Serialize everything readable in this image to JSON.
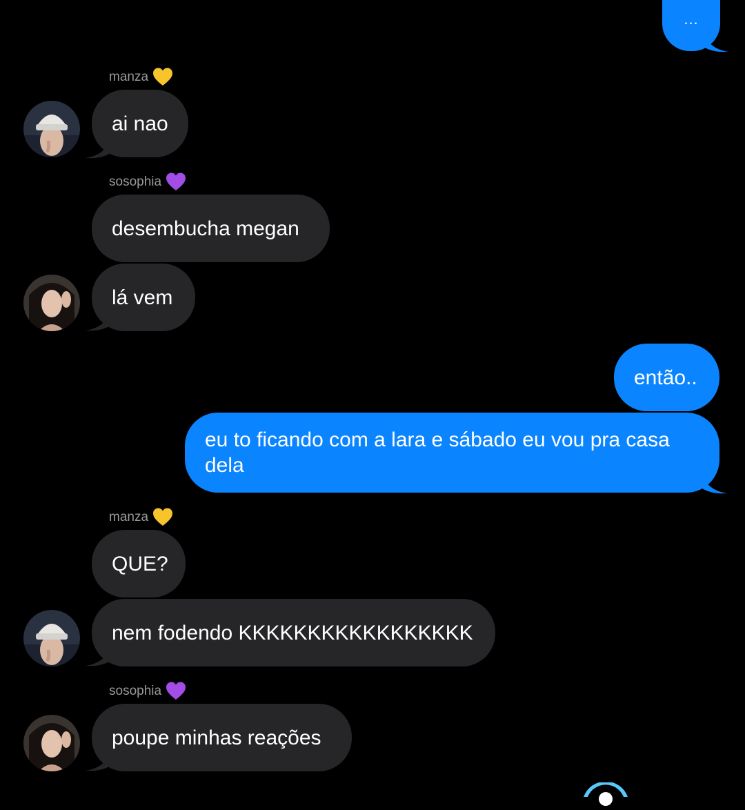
{
  "conversation": {
    "messages": [
      {
        "from": "me",
        "text": "..."
      },
      {
        "sender": "manza",
        "text": "ai nao"
      },
      {
        "sender": "sosophia",
        "text": "desembucha megan"
      },
      {
        "sender": "sosophia",
        "text": "lá vem"
      },
      {
        "from": "me",
        "text": "então.."
      },
      {
        "from": "me",
        "text": "eu to ficando com a lara e sábado eu vou pra casa dela"
      },
      {
        "sender": "manza",
        "text": "QUE?"
      },
      {
        "sender": "manza",
        "text": "nem fodendo KKKKKKKKKKKKKKKKK"
      },
      {
        "sender": "sosophia",
        "text": "poupe minhas reações"
      }
    ],
    "senders": {
      "manza": {
        "name": "manza",
        "heart_color": "#f7c52b",
        "heart_icon": "yellow-heart-icon"
      },
      "sosophia": {
        "name": "sosophia",
        "heart_color": "#a24de6",
        "heart_icon": "purple-heart-icon"
      }
    }
  },
  "colors": {
    "background": "#000000",
    "outgoing_bubble": "#0a84ff",
    "incoming_bubble": "#262629",
    "sender_label": "#9a9a9e"
  }
}
